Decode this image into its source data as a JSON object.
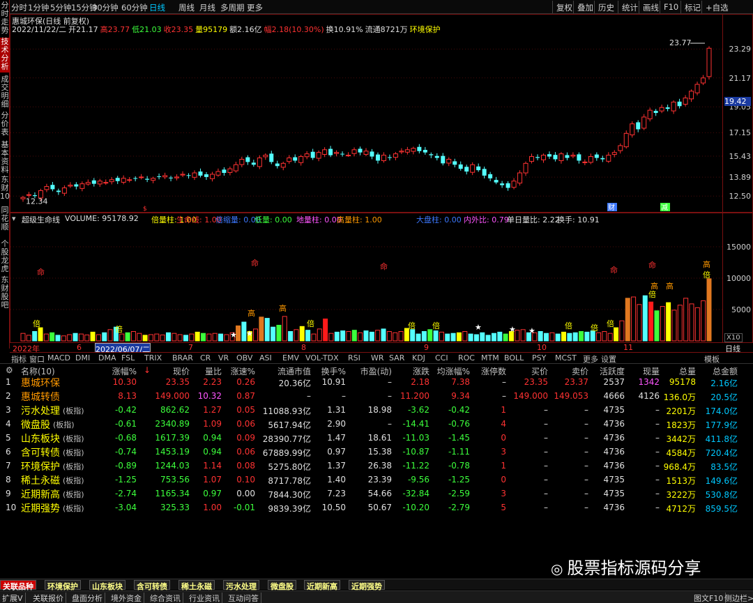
{
  "left_tabs": [
    "分时走势",
    "技术分析",
    "成交明细",
    "分价表",
    "基本资料",
    "东财10",
    "同花顺",
    "个股龙虎",
    "东财股吧"
  ],
  "toolbar": {
    "periods": [
      "分时",
      "1分钟",
      "5分钟",
      "15分钟",
      "30分钟",
      "60分钟",
      "日线",
      "周线",
      "月线",
      "多周期",
      "更多"
    ],
    "active": "日线",
    "right": [
      "复权",
      "叠加",
      "历史",
      "统计",
      "画线",
      "F10",
      "标记",
      "+自选"
    ]
  },
  "main_chart": {
    "title": "惠城环保(日线 前复权)",
    "info": {
      "date": "2022/11/22/二",
      "open_label": "开",
      "open": "21.17",
      "high_label": "高",
      "high": "23.77",
      "low_label": "低",
      "low": "21.03",
      "close_label": "收",
      "close": "23.35",
      "vol_label": "量",
      "vol": "95179",
      "amt_label": "额",
      "amt": "2.16亿",
      "chg_label": "幅",
      "chg": "2.18(10.30%)",
      "turnover": "换10.91%",
      "float": "流通8721万",
      "concept": "环境保护"
    },
    "y_ticks": [
      "23.29",
      "21.17",
      "19.05",
      "17.15",
      "15.43",
      "13.89",
      "12.50"
    ],
    "current_price": "19.42",
    "high_mark": "23.77",
    "low_mark": "12.34",
    "events": [
      "财",
      "减"
    ],
    "chart_data": {
      "type": "candlestick",
      "ylim": [
        11.6,
        25.0
      ],
      "closes": [
        12.4,
        12.6,
        12.5,
        12.9,
        13.2,
        13.0,
        12.8,
        13.1,
        13.3,
        13.2,
        13.4,
        13.5,
        13.4,
        13.6,
        13.5,
        13.7,
        13.6,
        13.8,
        13.7,
        13.8,
        13.9,
        13.7,
        13.8,
        13.9,
        14.0,
        13.8,
        13.9,
        14.1,
        14.0,
        14.2,
        14.0,
        13.9,
        14.1,
        14.3,
        14.2,
        14.5,
        14.8,
        15.2,
        15.0,
        14.8,
        15.3,
        15.5,
        15.0,
        14.7,
        14.9,
        15.3,
        15.1,
        15.4,
        15.6,
        15.3,
        15.7,
        15.9,
        15.5,
        15.7,
        15.6,
        15.5,
        15.9,
        15.7,
        15.8,
        15.4,
        15.1,
        15.5,
        15.3,
        15.6,
        15.8,
        15.9,
        16.0,
        15.8,
        15.7,
        15.5,
        15.3,
        14.9,
        15.2,
        14.8,
        14.5,
        14.3,
        14.8,
        14.4,
        14.0,
        13.8,
        13.5,
        13.3,
        13.1,
        13.6,
        14.2,
        14.9,
        15.4,
        15.3,
        15.5,
        15.4,
        15.2,
        15.6,
        15.3,
        15.5,
        15.1,
        15.0,
        15.4,
        15.3,
        15.2,
        15.5,
        15.7,
        16.2,
        17.1,
        17.8,
        17.4,
        18.3,
        18.8,
        18.6,
        19.0,
        18.9,
        19.4,
        19.1,
        19.7,
        20.2,
        20.7,
        21.17,
        23.35
      ],
      "low": 12.34,
      "high": 23.77
    }
  },
  "volume_chart": {
    "legend": [
      {
        "t": "超级生命线",
        "c": "#e0e0e0"
      },
      {
        "t": "VOLUME: 95178.92",
        "c": "#e0e0e0"
      },
      {
        "t": "倍量柱: 1.00",
        "c": "#ffff00"
      },
      {
        "t": "生命线: 1.00",
        "c": "#ff3232"
      },
      {
        "t": "倍缩量: 0.00",
        "c": "#3c78ff"
      },
      {
        "t": "低量: 0.00",
        "c": "#3cff3c"
      },
      {
        "t": "地量柱: 0.00",
        "c": "#ff55ff"
      },
      {
        "t": "高量柱: 1.00",
        "c": "#ff9900"
      },
      {
        "t": "大盘柱: 0.00",
        "c": "#3c78ff"
      },
      {
        "t": "内外比: 0.79",
        "c": "#ff55ff"
      },
      {
        "t": "单日量比: 2.22",
        "c": "#e0e0e0"
      },
      {
        "t": "换手: 10.91",
        "c": "#e0e0e0"
      }
    ],
    "y_ticks": [
      "15000",
      "10000",
      "5000"
    ],
    "unit": "X10",
    "marks": [
      "命",
      "高",
      "倍",
      "高"
    ],
    "chart_data": {
      "type": "bar",
      "ylim": [
        0,
        19000
      ],
      "values": [
        1200,
        900,
        1500,
        2100,
        1100,
        1300,
        900,
        800,
        1000,
        1200,
        1100,
        950,
        1400,
        1000,
        1300,
        1800,
        2200,
        1100,
        1300,
        1500,
        1200,
        900,
        1000,
        1100,
        950,
        1300,
        1200,
        1000,
        900,
        1100,
        1400,
        1200,
        1100,
        1200,
        1100,
        1000,
        1300,
        2400,
        3000,
        1500,
        1900,
        3800,
        3600,
        2200,
        2500,
        3900,
        1500,
        1800,
        2300,
        1700,
        1100,
        1900,
        3500,
        1200,
        1400,
        1600,
        1500,
        1700,
        1300,
        1600,
        1400,
        1700,
        1900,
        1500,
        1300,
        1500,
        2000,
        1800,
        1100,
        1500,
        1800,
        1600,
        1400,
        1100,
        1200,
        1300,
        1500,
        1100,
        1000,
        1300,
        900,
        1200,
        1400,
        1100,
        1500,
        1700,
        1800,
        1300,
        1300,
        1500,
        1200,
        1300,
        1100,
        1400,
        1200,
        1300,
        1500,
        1400,
        1600,
        1300,
        1500,
        1200,
        2100,
        3200,
        6800,
        7000,
        5800,
        7200,
        6200,
        4800,
        5500,
        6100,
        4900,
        5700,
        6800,
        5900,
        5300,
        6400,
        9900
      ]
    }
  },
  "x_axis": {
    "labels": [
      "2022年",
      "6",
      "2022/06/07/二",
      "7",
      "8",
      "9",
      "10",
      "11"
    ],
    "right": "日线"
  },
  "indicators": [
    "指标",
    "窗口",
    "MACD",
    "DMI",
    "DMA",
    "FSL",
    "TRIX",
    "BRAR",
    "CR",
    "VR",
    "OBV",
    "ASI",
    "EMV",
    "VOL-TDX",
    "RSI",
    "WR",
    "SAR",
    "KDJ",
    "CCI",
    "ROC",
    "MTM",
    "BOLL",
    "PSY",
    "MCST",
    "更多",
    "设置"
  ],
  "indicator_right": "模板",
  "table": {
    "headers": [
      "名称(10)",
      "涨幅%",
      "现价",
      "量比",
      "涨速%",
      "流通市值",
      "换手%",
      "市盈(动)",
      "涨跌",
      "均涨幅%",
      "涨停数",
      "买价",
      "卖价",
      "活跃度",
      "现量",
      "总量",
      "总金额"
    ],
    "rows": [
      {
        "no": "1",
        "name": "惠城环保",
        "tag": "",
        "c": [
          "10.30",
          "23.35",
          "2.23",
          "0.26",
          "20.36亿",
          "10.91",
          "–",
          "2.18",
          "7.38",
          "–",
          "23.35",
          "23.37",
          "2537",
          "1342",
          "95178",
          "2.16亿"
        ],
        "nc": "orange"
      },
      {
        "no": "2",
        "name": "惠城转债",
        "tag": "",
        "c": [
          "8.13",
          "149.000",
          "10.32",
          "0.87",
          "–",
          "–",
          "–",
          "11.200",
          "9.34",
          "–",
          "149.000",
          "149.053",
          "4666",
          "4126",
          "136.0万",
          "20.5亿"
        ],
        "nc": "orange"
      },
      {
        "no": "3",
        "name": "污水处理",
        "tag": "(板指)",
        "c": [
          "-0.42",
          "862.62",
          "1.27",
          "0.05",
          "11088.93亿",
          "1.31",
          "18.98",
          "-3.62",
          "-0.42",
          "1",
          "–",
          "–",
          "4735",
          "–",
          "2201万",
          "174.0亿"
        ],
        "nc": "yellow"
      },
      {
        "no": "4",
        "name": "微盘股",
        "tag": "(板指)",
        "c": [
          "-0.61",
          "2340.89",
          "1.09",
          "0.06",
          "5617.94亿",
          "2.90",
          "–",
          "-14.41",
          "-0.76",
          "4",
          "–",
          "–",
          "4736",
          "–",
          "1823万",
          "177.9亿"
        ],
        "nc": "yellow"
      },
      {
        "no": "5",
        "name": "山东板块",
        "tag": "(板指)",
        "c": [
          "-0.68",
          "1617.39",
          "0.94",
          "0.09",
          "28390.77亿",
          "1.47",
          "18.61",
          "-11.03",
          "-1.45",
          "0",
          "–",
          "–",
          "4736",
          "–",
          "3442万",
          "411.8亿"
        ],
        "nc": "yellow"
      },
      {
        "no": "6",
        "name": "含可转债",
        "tag": "(板指)",
        "c": [
          "-0.74",
          "1453.19",
          "0.94",
          "0.06",
          "67889.99亿",
          "0.97",
          "15.38",
          "-10.87",
          "-1.11",
          "3",
          "–",
          "–",
          "4736",
          "–",
          "4584万",
          "720.4亿"
        ],
        "nc": "yellow"
      },
      {
        "no": "7",
        "name": "环境保护",
        "tag": "(板指)",
        "c": [
          "-0.89",
          "1244.03",
          "1.14",
          "0.08",
          "5275.80亿",
          "1.37",
          "26.38",
          "-11.22",
          "-0.78",
          "1",
          "–",
          "–",
          "4736",
          "–",
          "968.4万",
          "83.5亿"
        ],
        "nc": "yellow"
      },
      {
        "no": "8",
        "name": "稀土永磁",
        "tag": "(板指)",
        "c": [
          "-1.25",
          "753.56",
          "1.07",
          "0.10",
          "8717.78亿",
          "1.40",
          "23.39",
          "-9.56",
          "-1.25",
          "0",
          "–",
          "–",
          "4735",
          "–",
          "1513万",
          "149.6亿"
        ],
        "nc": "yellow"
      },
      {
        "no": "9",
        "name": "近期新高",
        "tag": "(板指)",
        "c": [
          "-2.74",
          "1165.34",
          "0.97",
          "0.00",
          "7844.30亿",
          "7.23",
          "54.66",
          "-32.84",
          "-2.59",
          "3",
          "–",
          "–",
          "4735",
          "–",
          "3222万",
          "530.8亿"
        ],
        "nc": "yellow"
      },
      {
        "no": "10",
        "name": "近期强势",
        "tag": "(板指)",
        "c": [
          "-3.04",
          "325.33",
          "1.00",
          "-0.01",
          "9839.39亿",
          "10.50",
          "50.67",
          "-10.20",
          "-2.79",
          "5",
          "–",
          "–",
          "4736",
          "–",
          "4712万",
          "859.5亿"
        ],
        "nc": "yellow"
      }
    ]
  },
  "bottom_tabs": [
    "关联品种",
    "环境保护",
    "山东板块",
    "含可转债",
    "稀土永磁",
    "污水处理",
    "微盘股",
    "近期新高",
    "近期强势"
  ],
  "status": [
    "扩展V",
    "关联报价",
    "盘面分析",
    "境外资金",
    "综合资讯",
    "行业资讯",
    "互动问答"
  ],
  "status_right": [
    "图文F10",
    "侧边栏>"
  ],
  "watermark": "股票指标源码分享"
}
